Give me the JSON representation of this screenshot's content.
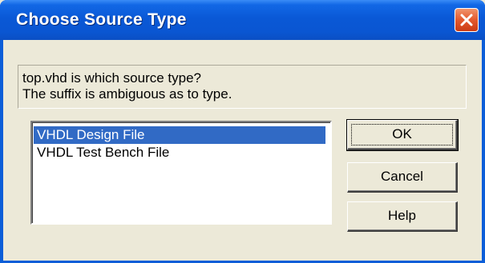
{
  "window": {
    "title": "Choose Source Type",
    "close_icon": "close-icon"
  },
  "message": {
    "line1": "top.vhd is which source type?",
    "line2": "The suffix is ambiguous as to type."
  },
  "list": {
    "items": [
      {
        "label": "VHDL Design File",
        "selected": true
      },
      {
        "label": "VHDL Test Bench File",
        "selected": false
      }
    ]
  },
  "buttons": {
    "ok_label": "OK",
    "cancel_label": "Cancel",
    "help_label": "Help"
  },
  "colors": {
    "titlebar": "#0a58d6",
    "selection": "#316ac5",
    "close_button": "#e4592e",
    "dialog_bg": "#ece9d8"
  }
}
